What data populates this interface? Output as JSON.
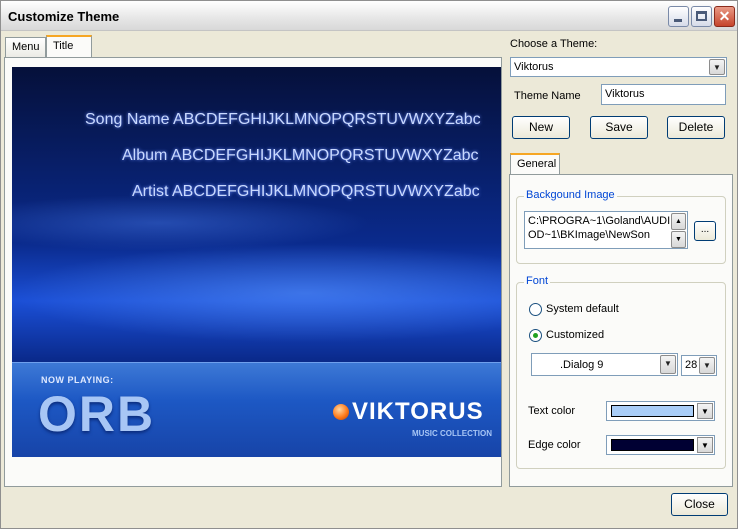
{
  "window": {
    "title": "Customize Theme",
    "close_glyph": "✕"
  },
  "left_tabs": [
    {
      "label": "Menu",
      "active": false
    },
    {
      "label": "Title",
      "active": true
    }
  ],
  "preview": {
    "song_line": "Song Name ABCDEFGHIJKLMNOPQRSTUVWXYZabc",
    "album_line": "Album ABCDEFGHIJKLMNOPQRSTUVWXYZabc",
    "artist_line": "Artist ABCDEFGHIJKLMNOPQRSTUVWXYZabc",
    "now_playing": "NOW PLAYING:",
    "orb": "ORB",
    "brand": "VIKTORUS",
    "brand_sub": "MUSIC COLLECTION"
  },
  "theme": {
    "choose_label": "Choose a Theme:",
    "selected": "Viktorus",
    "name_label": "Theme Name",
    "name_value": "Viktorus"
  },
  "buttons": {
    "new": "New",
    "save": "Save",
    "delete": "Delete",
    "close": "Close",
    "browse": "..."
  },
  "right_tab": "General",
  "background_image": {
    "title": "Backgound Image",
    "path": "C:\\PROGRA~1\\Goland\\AUDIOD~1\\BKImage\\NewSon"
  },
  "font": {
    "title": "Font",
    "option_system": "System default",
    "option_custom": "Customized",
    "selected_option": "Customized",
    "font_name": ".Dialog 9",
    "font_size": "28",
    "text_color_label": "Text color",
    "edge_color_label": "Edge color",
    "text_color": "#a9cdf7",
    "edge_color": "#000033"
  },
  "icons": {
    "dropdown": "▼",
    "spin_up": "▲",
    "spin_down": "▼"
  }
}
